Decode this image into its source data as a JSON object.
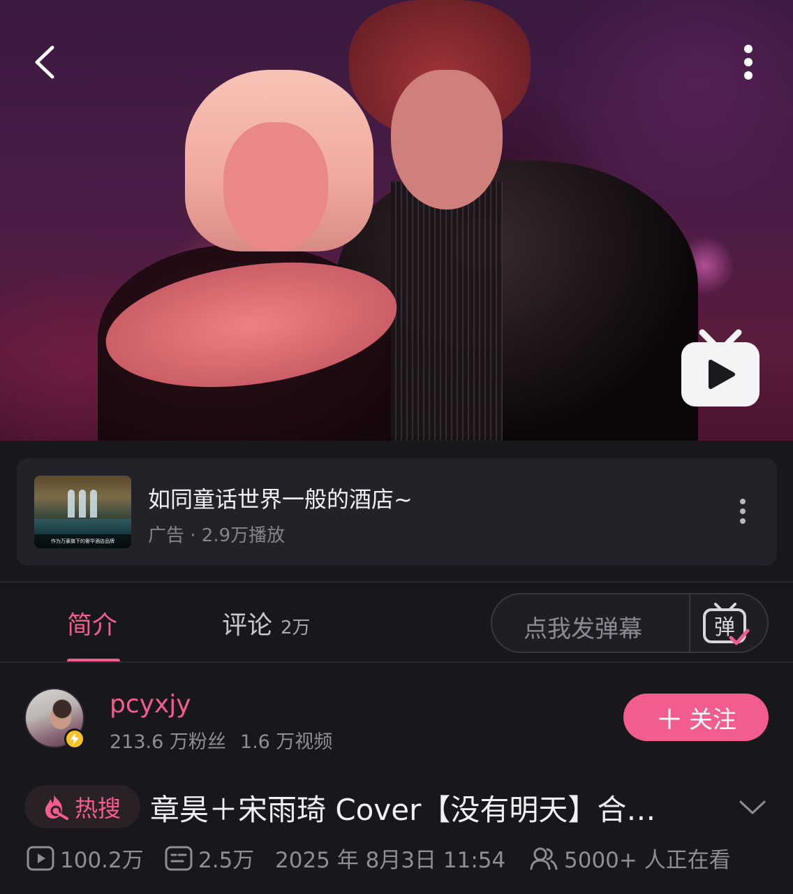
{
  "player": {
    "icons": {
      "back": "chevron-left-icon",
      "more": "more-vertical-icon",
      "logo": "bilibili-tv-icon"
    }
  },
  "ad": {
    "title": "如同童话世界一般的酒店~",
    "meta": "广告 · 2.9万播放",
    "thumb_caption": "作为万豪旗下的奢华酒店品牌"
  },
  "tabs": {
    "intro": "简介",
    "comments": "评论",
    "comments_count": "2万"
  },
  "danmaku": {
    "placeholder": "点我发弹幕",
    "icon_char": "弹"
  },
  "uploader": {
    "name": "pcyxjy",
    "fans": "213.6 万粉丝",
    "videos": "1.6 万视频",
    "follow_label": "关注"
  },
  "video": {
    "hot_label": "热搜",
    "title": "章昊＋宋雨琦 Cover【没有明天】合…",
    "plays": "100.2万",
    "danmaku_count": "2.5万",
    "date": "2025 年 8月3日 11:54",
    "watching": "5000+ 人正在看"
  },
  "colors": {
    "accent": "#f25d8e",
    "background": "#18171c",
    "card": "#232228",
    "muted_text": "#8f8e96"
  }
}
